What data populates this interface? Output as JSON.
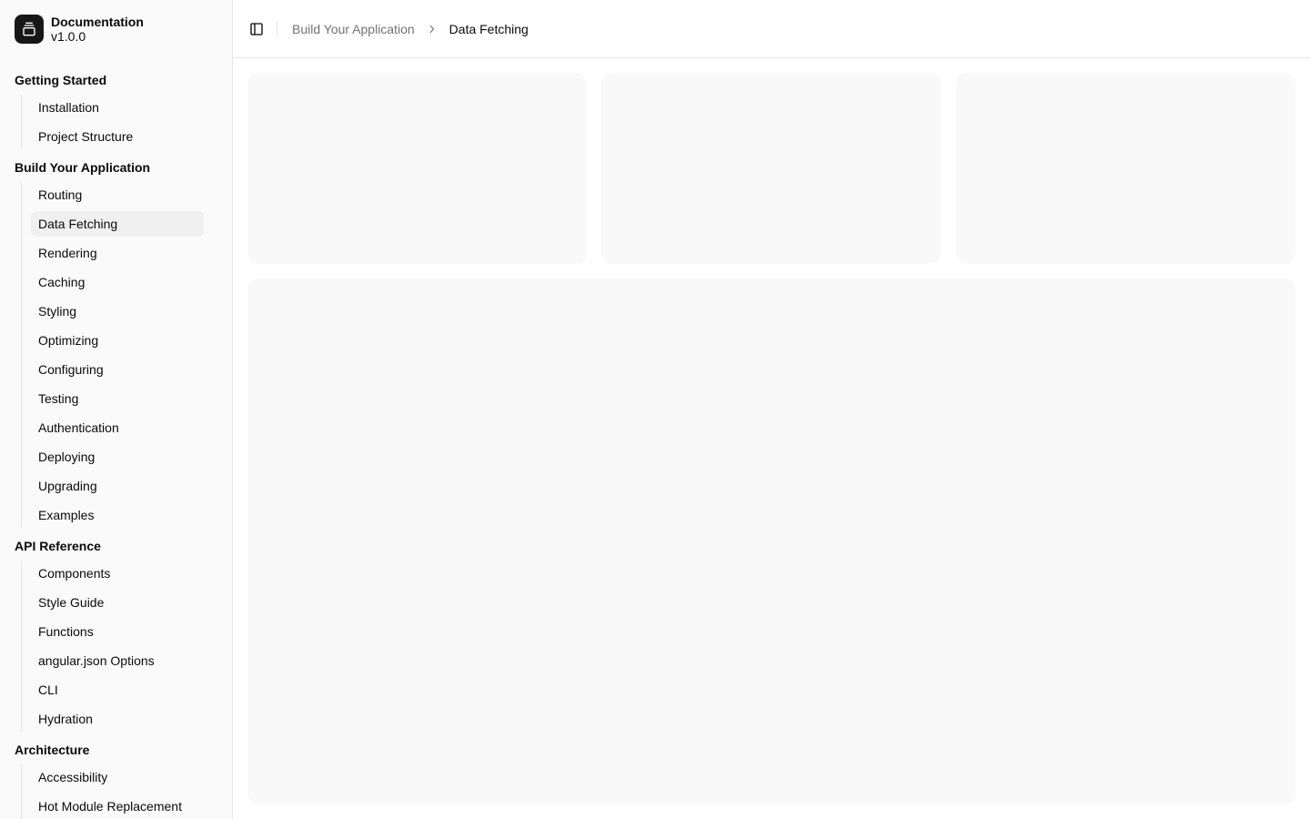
{
  "brand": {
    "title": "Documentation",
    "version": "v1.0.0",
    "icon": "gallery-vertical-end-icon"
  },
  "breadcrumb": {
    "parent": "Build Your Application",
    "current": "Data Fetching"
  },
  "nav": [
    {
      "label": "Getting Started",
      "items": [
        {
          "label": "Installation"
        },
        {
          "label": "Project Structure"
        }
      ]
    },
    {
      "label": "Build Your Application",
      "items": [
        {
          "label": "Routing"
        },
        {
          "label": "Data Fetching",
          "active": true
        },
        {
          "label": "Rendering"
        },
        {
          "label": "Caching"
        },
        {
          "label": "Styling"
        },
        {
          "label": "Optimizing"
        },
        {
          "label": "Configuring"
        },
        {
          "label": "Testing"
        },
        {
          "label": "Authentication"
        },
        {
          "label": "Deploying"
        },
        {
          "label": "Upgrading"
        },
        {
          "label": "Examples"
        }
      ]
    },
    {
      "label": "API Reference",
      "items": [
        {
          "label": "Components"
        },
        {
          "label": "Style Guide"
        },
        {
          "label": "Functions"
        },
        {
          "label": "angular.json Options"
        },
        {
          "label": "CLI"
        },
        {
          "label": "Hydration"
        }
      ]
    },
    {
      "label": "Architecture",
      "items": [
        {
          "label": "Accessibility"
        },
        {
          "label": "Hot Module Replacement"
        }
      ]
    }
  ]
}
